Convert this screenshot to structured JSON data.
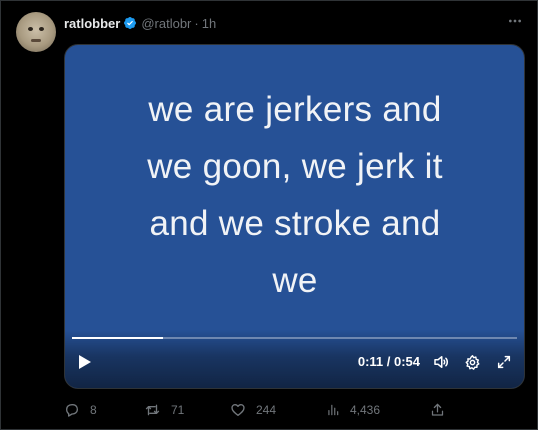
{
  "tweet": {
    "display_name": "ratlobber",
    "handle": "@ratlobr",
    "separator": "·",
    "time": "1h",
    "verified": true
  },
  "video": {
    "caption_lines": [
      "we are jerkers and",
      "we goon, we jerk it",
      "and we stroke and",
      "we"
    ],
    "time_readout": "0:11 / 0:54",
    "progress": 0.205,
    "background_color": "#265196"
  },
  "actions": {
    "replies": "8",
    "reposts": "71",
    "likes": "244",
    "views": "4,436"
  },
  "colors": {
    "accent_verified": "#1d9bf0",
    "muted_text": "#71767b",
    "primary_text": "#e7e9ea"
  },
  "icons": {
    "more": "more-horizontal-icon",
    "play": "play-icon",
    "volume": "volume-icon",
    "settings": "gear-icon",
    "fullscreen": "fullscreen-icon",
    "reply": "reply-icon",
    "repost": "repost-icon",
    "like": "heart-icon",
    "views": "views-icon",
    "share": "share-icon"
  }
}
